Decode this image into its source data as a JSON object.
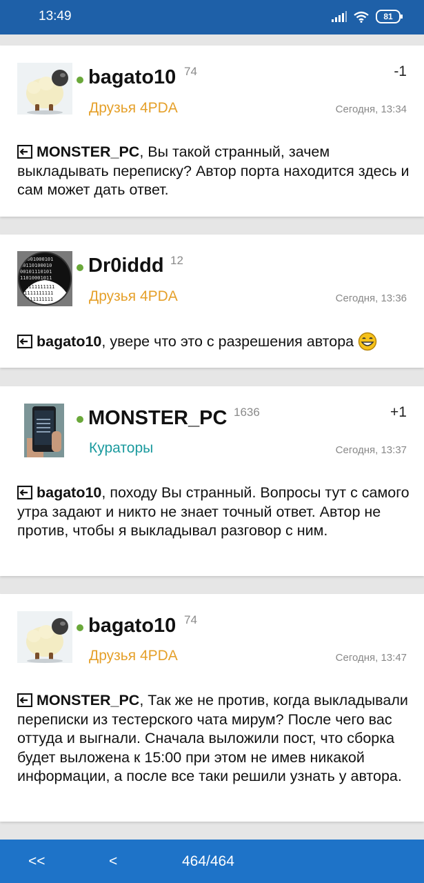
{
  "status_bar": {
    "time": "13:49",
    "battery": "81"
  },
  "posts": [
    {
      "username": "bagato10",
      "reputation": "74",
      "group": "Друзья 4PDA",
      "group_color": "#e5a02a",
      "rating": "-1",
      "time": "Сегодня, 13:34",
      "quote_nick": "MONSTER_PC",
      "text": ", Вы такой странный, зачем выкладывать переписку? Автор порта находится здесь и сам может дать ответ."
    },
    {
      "username": "Dr0iddd",
      "reputation": "12",
      "group": "Друзья 4PDA",
      "group_color": "#e5a02a",
      "rating": "",
      "time": "Сегодня, 13:36",
      "quote_nick": "bagato10",
      "text": ", увере что это с разрешения автора"
    },
    {
      "username": "MONSTER_PC",
      "reputation": "1636",
      "group": "Кураторы",
      "group_color": "#1b9a9e",
      "rating": "+1",
      "time": "Сегодня, 13:37",
      "quote_nick": "bagato10",
      "text": ", походу Вы странный. Вопросы тут с самого утра задают и никто не знает точный ответ. Автор не против, чтобы я выкладывал разговор с ним."
    },
    {
      "username": "bagato10",
      "reputation": "74",
      "group": "Друзья 4PDA",
      "group_color": "#e5a02a",
      "rating": "",
      "time": "Сегодня, 13:47",
      "quote_nick": "MONSTER_PC",
      "text": ", Так же не против, когда выкладывали переписки из тестерского чата мирум? После чего вас оттуда и выгнали. Сначала выложили пост, что сборка будет выложена к 15:00 при этом не имев никакой информации, а после все таки решили узнать у автора."
    }
  ],
  "nav": {
    "first": "<<",
    "prev": "<",
    "pages": "464/464"
  }
}
